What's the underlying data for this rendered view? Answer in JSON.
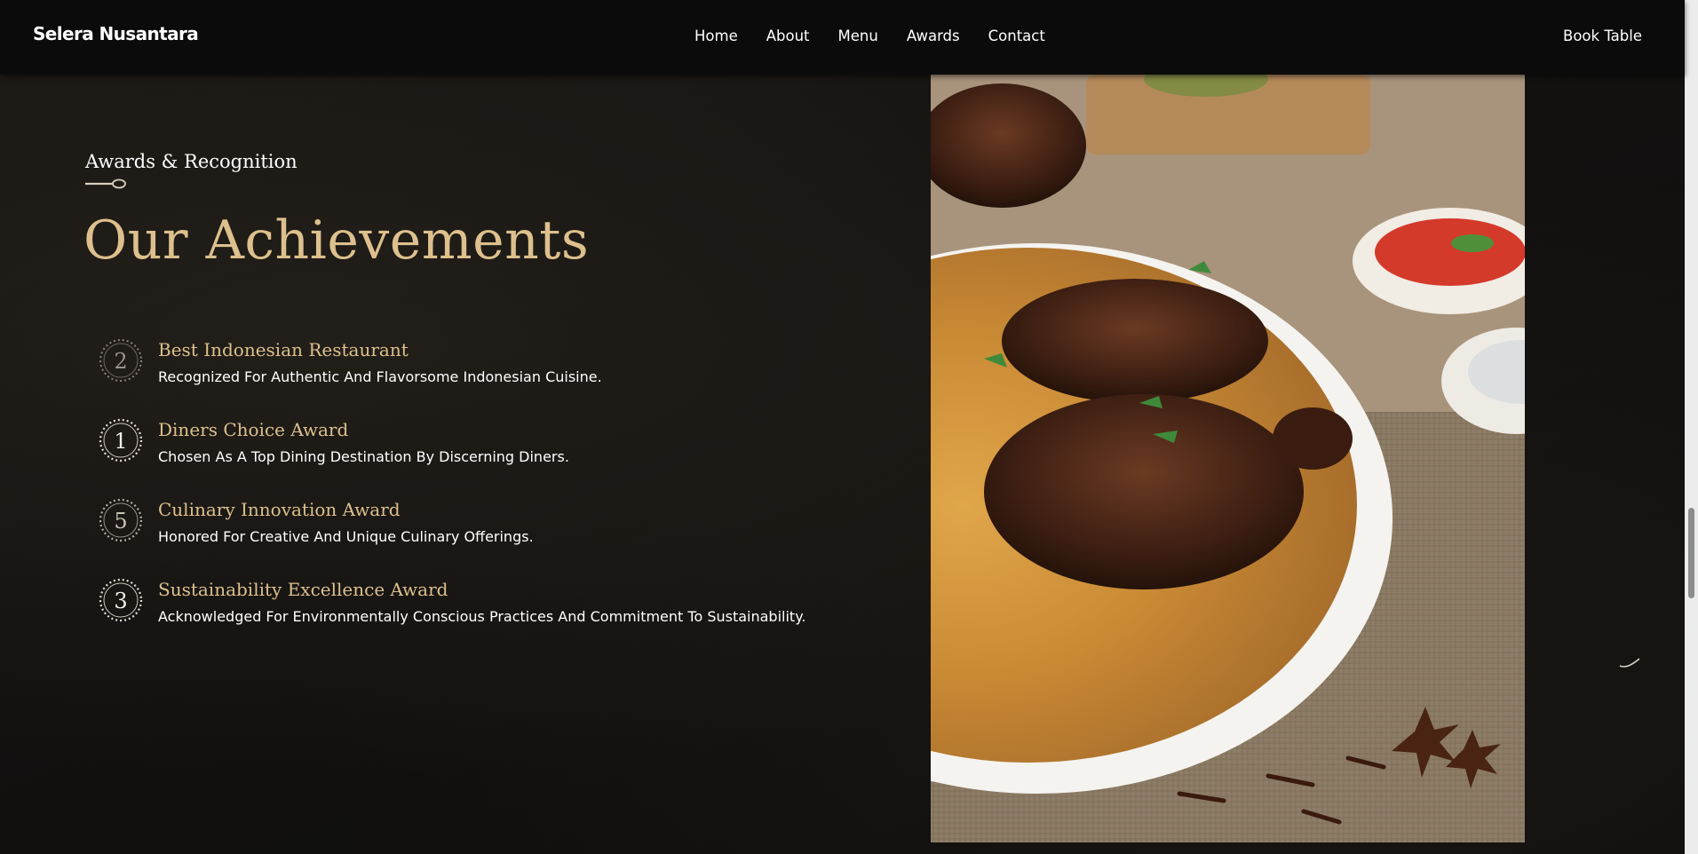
{
  "navbar": {
    "brand": "Selera Nusantara",
    "links": [
      "Home",
      "About",
      "Menu",
      "Awards",
      "Contact"
    ],
    "cta": "Book Table"
  },
  "section": {
    "kicker": "Awards & Recognition",
    "heading": "Our Achievements",
    "awards": [
      {
        "rank": "2",
        "title": "Best Indonesian Restaurant",
        "description": "Recognized For Authentic And Flavorsome Indonesian Cuisine."
      },
      {
        "rank": "1",
        "title": "Diners Choice Award",
        "description": "Chosen As A Top Dining Destination By Discerning Diners."
      },
      {
        "rank": "5",
        "title": "Culinary Innovation Award",
        "description": "Honored For Creative And Unique Culinary Offerings."
      },
      {
        "rank": "3",
        "title": "Sustainability Excellence Award",
        "description": "Acknowledged For Environmentally Conscious Practices And Commitment To Sustainability."
      }
    ]
  },
  "colors": {
    "accent": "#ddc08d",
    "navbar": "#0b0b0b",
    "background": "#121110"
  }
}
